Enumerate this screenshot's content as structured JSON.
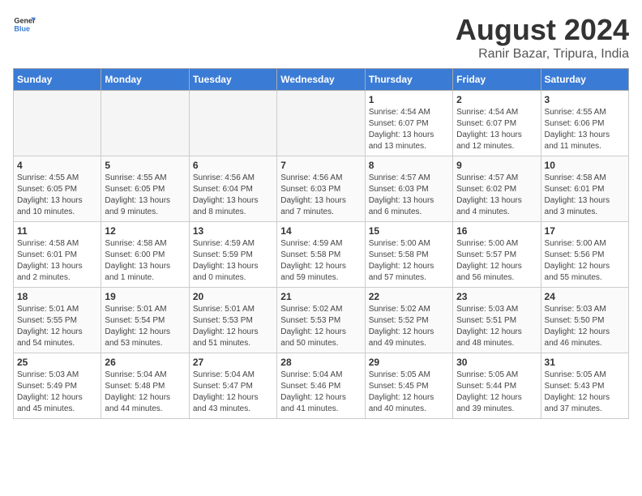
{
  "header": {
    "logo_general": "General",
    "logo_blue": "Blue",
    "month_year": "August 2024",
    "location": "Ranir Bazar, Tripura, India"
  },
  "weekdays": [
    "Sunday",
    "Monday",
    "Tuesday",
    "Wednesday",
    "Thursday",
    "Friday",
    "Saturday"
  ],
  "weeks": [
    [
      {
        "day": "",
        "info": ""
      },
      {
        "day": "",
        "info": ""
      },
      {
        "day": "",
        "info": ""
      },
      {
        "day": "",
        "info": ""
      },
      {
        "day": "1",
        "info": "Sunrise: 4:54 AM\nSunset: 6:07 PM\nDaylight: 13 hours\nand 13 minutes."
      },
      {
        "day": "2",
        "info": "Sunrise: 4:54 AM\nSunset: 6:07 PM\nDaylight: 13 hours\nand 12 minutes."
      },
      {
        "day": "3",
        "info": "Sunrise: 4:55 AM\nSunset: 6:06 PM\nDaylight: 13 hours\nand 11 minutes."
      }
    ],
    [
      {
        "day": "4",
        "info": "Sunrise: 4:55 AM\nSunset: 6:05 PM\nDaylight: 13 hours\nand 10 minutes."
      },
      {
        "day": "5",
        "info": "Sunrise: 4:55 AM\nSunset: 6:05 PM\nDaylight: 13 hours\nand 9 minutes."
      },
      {
        "day": "6",
        "info": "Sunrise: 4:56 AM\nSunset: 6:04 PM\nDaylight: 13 hours\nand 8 minutes."
      },
      {
        "day": "7",
        "info": "Sunrise: 4:56 AM\nSunset: 6:03 PM\nDaylight: 13 hours\nand 7 minutes."
      },
      {
        "day": "8",
        "info": "Sunrise: 4:57 AM\nSunset: 6:03 PM\nDaylight: 13 hours\nand 6 minutes."
      },
      {
        "day": "9",
        "info": "Sunrise: 4:57 AM\nSunset: 6:02 PM\nDaylight: 13 hours\nand 4 minutes."
      },
      {
        "day": "10",
        "info": "Sunrise: 4:58 AM\nSunset: 6:01 PM\nDaylight: 13 hours\nand 3 minutes."
      }
    ],
    [
      {
        "day": "11",
        "info": "Sunrise: 4:58 AM\nSunset: 6:01 PM\nDaylight: 13 hours\nand 2 minutes."
      },
      {
        "day": "12",
        "info": "Sunrise: 4:58 AM\nSunset: 6:00 PM\nDaylight: 13 hours\nand 1 minute."
      },
      {
        "day": "13",
        "info": "Sunrise: 4:59 AM\nSunset: 5:59 PM\nDaylight: 13 hours\nand 0 minutes."
      },
      {
        "day": "14",
        "info": "Sunrise: 4:59 AM\nSunset: 5:58 PM\nDaylight: 12 hours\nand 59 minutes."
      },
      {
        "day": "15",
        "info": "Sunrise: 5:00 AM\nSunset: 5:58 PM\nDaylight: 12 hours\nand 57 minutes."
      },
      {
        "day": "16",
        "info": "Sunrise: 5:00 AM\nSunset: 5:57 PM\nDaylight: 12 hours\nand 56 minutes."
      },
      {
        "day": "17",
        "info": "Sunrise: 5:00 AM\nSunset: 5:56 PM\nDaylight: 12 hours\nand 55 minutes."
      }
    ],
    [
      {
        "day": "18",
        "info": "Sunrise: 5:01 AM\nSunset: 5:55 PM\nDaylight: 12 hours\nand 54 minutes."
      },
      {
        "day": "19",
        "info": "Sunrise: 5:01 AM\nSunset: 5:54 PM\nDaylight: 12 hours\nand 53 minutes."
      },
      {
        "day": "20",
        "info": "Sunrise: 5:01 AM\nSunset: 5:53 PM\nDaylight: 12 hours\nand 51 minutes."
      },
      {
        "day": "21",
        "info": "Sunrise: 5:02 AM\nSunset: 5:53 PM\nDaylight: 12 hours\nand 50 minutes."
      },
      {
        "day": "22",
        "info": "Sunrise: 5:02 AM\nSunset: 5:52 PM\nDaylight: 12 hours\nand 49 minutes."
      },
      {
        "day": "23",
        "info": "Sunrise: 5:03 AM\nSunset: 5:51 PM\nDaylight: 12 hours\nand 48 minutes."
      },
      {
        "day": "24",
        "info": "Sunrise: 5:03 AM\nSunset: 5:50 PM\nDaylight: 12 hours\nand 46 minutes."
      }
    ],
    [
      {
        "day": "25",
        "info": "Sunrise: 5:03 AM\nSunset: 5:49 PM\nDaylight: 12 hours\nand 45 minutes."
      },
      {
        "day": "26",
        "info": "Sunrise: 5:04 AM\nSunset: 5:48 PM\nDaylight: 12 hours\nand 44 minutes."
      },
      {
        "day": "27",
        "info": "Sunrise: 5:04 AM\nSunset: 5:47 PM\nDaylight: 12 hours\nand 43 minutes."
      },
      {
        "day": "28",
        "info": "Sunrise: 5:04 AM\nSunset: 5:46 PM\nDaylight: 12 hours\nand 41 minutes."
      },
      {
        "day": "29",
        "info": "Sunrise: 5:05 AM\nSunset: 5:45 PM\nDaylight: 12 hours\nand 40 minutes."
      },
      {
        "day": "30",
        "info": "Sunrise: 5:05 AM\nSunset: 5:44 PM\nDaylight: 12 hours\nand 39 minutes."
      },
      {
        "day": "31",
        "info": "Sunrise: 5:05 AM\nSunset: 5:43 PM\nDaylight: 12 hours\nand 37 minutes."
      }
    ]
  ]
}
